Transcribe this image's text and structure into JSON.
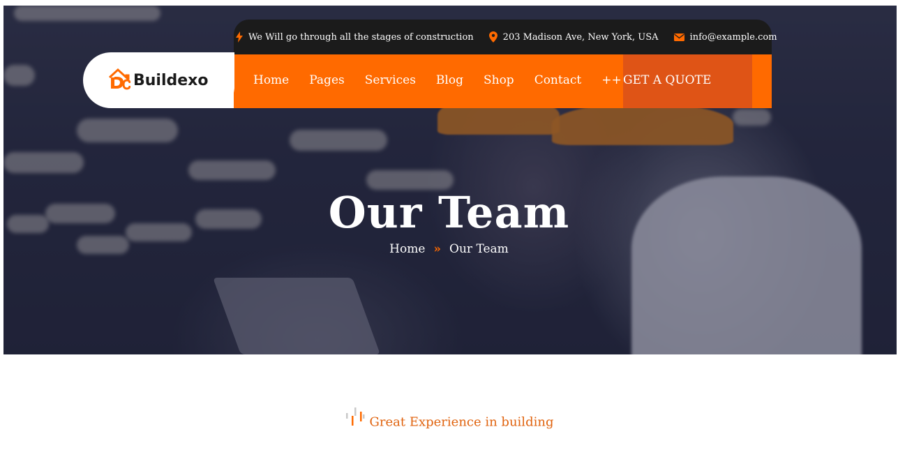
{
  "topbar": {
    "tagline": "We Will go through all the stages of construction",
    "address": "203 Madison Ave, New York, USA",
    "email": "info@example.com"
  },
  "logo": {
    "text": "Buildexo"
  },
  "nav": {
    "items": [
      "Home",
      "Pages",
      "Services",
      "Blog",
      "Shop",
      "Contact",
      "++"
    ],
    "cta": "GET A QUOTE"
  },
  "hero": {
    "title": "Our Team",
    "breadcrumb": {
      "home": "Home",
      "current": "Our Team"
    }
  },
  "section": {
    "subtitle": "Great Experience in building"
  },
  "colors": {
    "accent": "#ff6a00",
    "accent_dark": "#df5416",
    "topbar": "#1b1b1b"
  }
}
